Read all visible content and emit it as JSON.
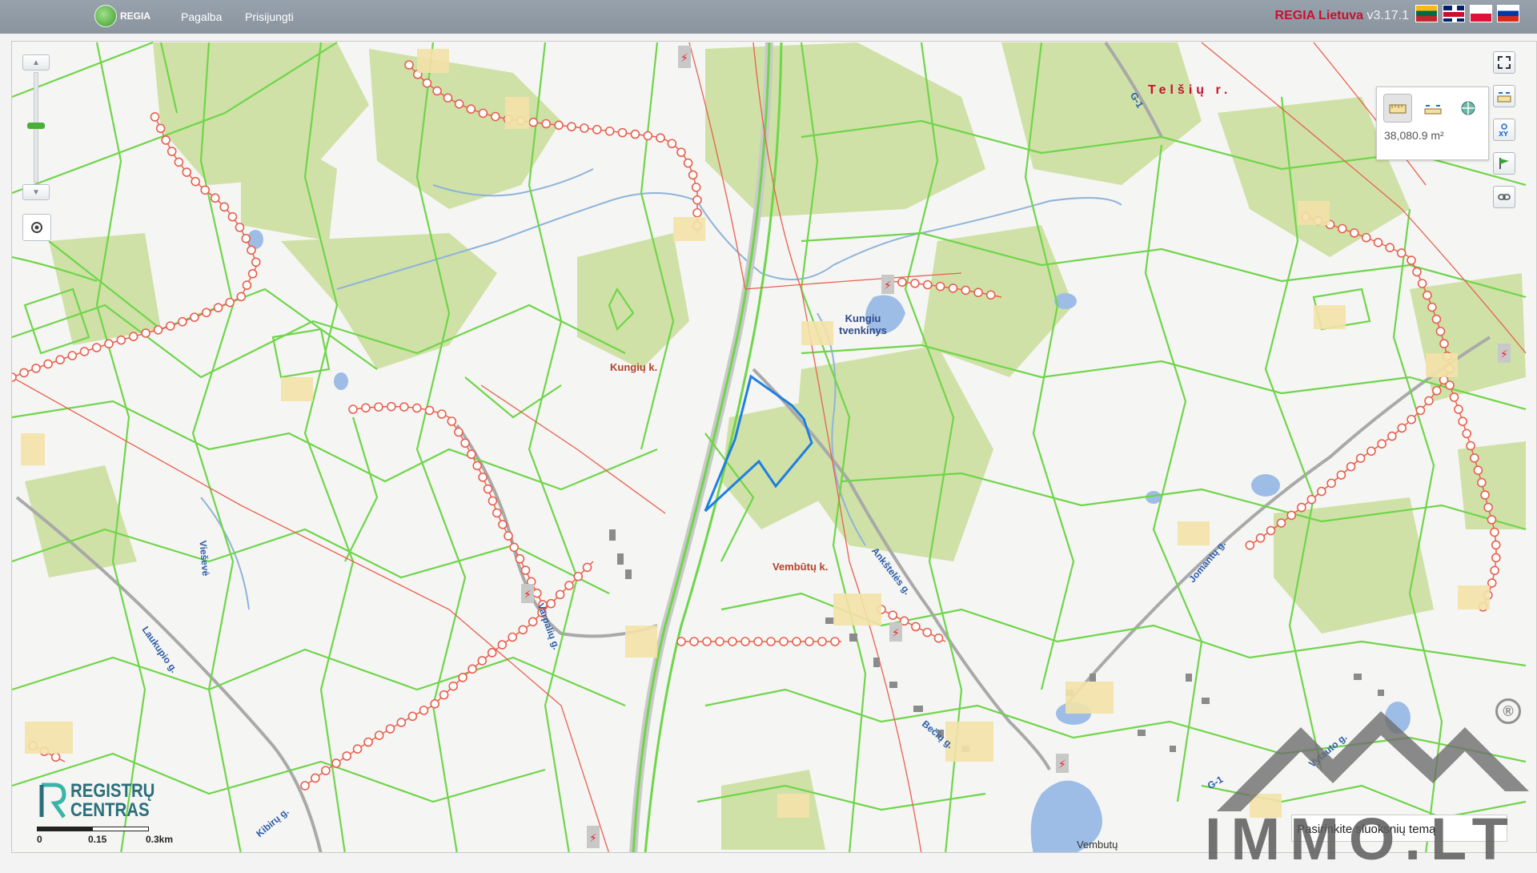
{
  "header": {
    "brand_label": "REGIA",
    "nav": {
      "help": "Pagalba",
      "login": "Prisijungti"
    },
    "title": "REGIA Lietuva",
    "version": "v3.17.1",
    "flags": [
      "lithuanian-flag",
      "english-flag",
      "polish-flag",
      "russian-flag"
    ]
  },
  "measure": {
    "value": "38,080.9 m²"
  },
  "labels": {
    "district": "Telšių r.",
    "kungiu_village": "Kungių k.",
    "kungiu_lake": "Kungiu\ntvenkinys",
    "vembutu_village": "Vembūtų k.",
    "vembutu_lake": "Vembutų",
    "road_ankstes": "Ankštelės g.",
    "road_jomantu": "Jomantų g.",
    "road_varpaliu": "Varpalių g.",
    "road_laukupio": "Laukupio g.",
    "road_vieszvio": "Vieševė",
    "road_kibir": "Kibirų g.",
    "road_g1_top": "G-1",
    "road_g1_bottom": "G-1",
    "road_beczio": "Bečių g.",
    "road_vytauto": "Vytauto g."
  },
  "logo": {
    "registru_line1": "REGISTRŲ",
    "registru_line2": "CENTRAS"
  },
  "scale": {
    "t0": "0",
    "t1": "0.15",
    "t2": "0.3km"
  },
  "search": {
    "text": "Pasirinkite sluoksnių temą"
  },
  "watermark": {
    "text": "IMMO.LT",
    "mark": "®"
  },
  "colors": {
    "parcel": "#6fd54a",
    "forest": "#cfe1a6",
    "powerline": "#e8604f",
    "road": "#a9a9a9",
    "water": "#9dbde6",
    "selection": "#1f7fe0"
  }
}
